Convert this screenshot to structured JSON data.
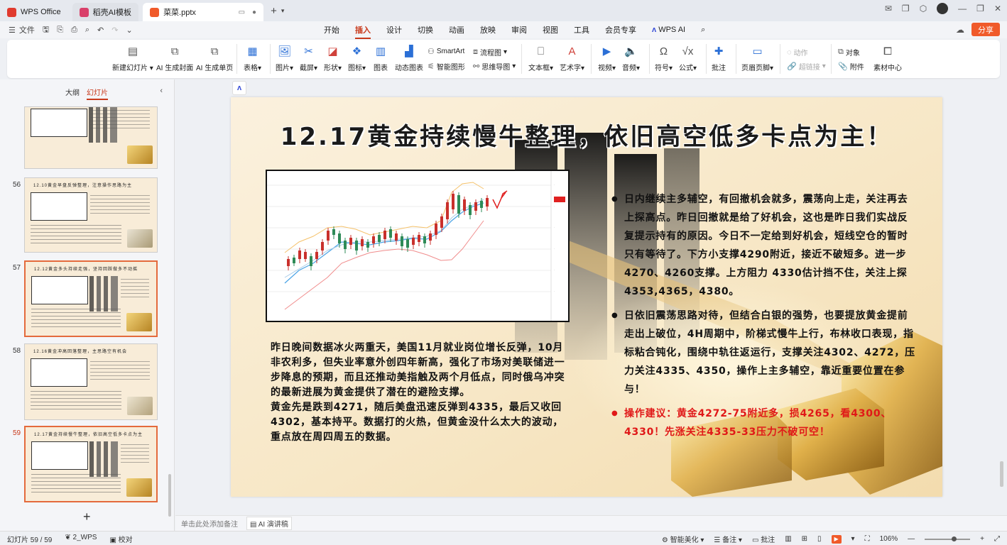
{
  "tabs": [
    {
      "label": "WPS Office",
      "color": "#e03a2e"
    },
    {
      "label": "稻壳AI模板",
      "color": "#d9406a"
    },
    {
      "label": "菜菜.pptx",
      "color": "#f05a2a"
    }
  ],
  "menu": {
    "file": "文件",
    "tabs": [
      "开始",
      "插入",
      "设计",
      "切换",
      "动画",
      "放映",
      "审阅",
      "视图",
      "工具",
      "会员专享",
      "WPS AI"
    ],
    "active_tab": "插入",
    "share": "分享"
  },
  "ribbon": {
    "new_slide": "新建幻灯片",
    "ai_cover": "AI 生成封面",
    "ai_page": "AI 生成单页",
    "table": "表格",
    "picture": "图片",
    "screenshot": "截屏",
    "shape": "形状",
    "icon": "图标",
    "chart": "图表",
    "dynamic_chart": "动态图表",
    "smartart": "SmartArt",
    "smart_shape": "智能图形",
    "flowchart": "流程图",
    "mindmap": "思维导图",
    "textbox": "文本框",
    "wordart": "艺术字",
    "video": "视频",
    "audio": "音频",
    "symbol": "符号",
    "formula": "公式",
    "comment": "批注",
    "header_footer": "页眉页脚",
    "action": "动作",
    "hyperlink": "超链接",
    "object": "对象",
    "attachment": "附件",
    "material": "素材中心"
  },
  "left_panel": {
    "outline_tab": "大纲",
    "slides_tab": "幻灯片",
    "thumbs": [
      {
        "num": "",
        "title": ""
      },
      {
        "num": "56",
        "title": "12.10黄金早盘反弹整理，注意操作思路为主"
      },
      {
        "num": "57",
        "title": "12.12黄金多头持续走强，坚持回踩做多不动摇"
      },
      {
        "num": "58",
        "title": "12.16黄金冲高回落整理，主思路空有机会"
      },
      {
        "num": "59",
        "title": "12.17黄金持续慢牛整理，依旧高空低多卡点为主"
      }
    ],
    "add": "+"
  },
  "slide": {
    "title": "12.17黄金持续慢牛整理，依旧高空低多卡点为主！",
    "paragraph_1": "昨日晚间数据冰火两重天，美国11月就业岗位增长反弹，10月非农利多，但失业率意外创四年新高，强化了市场对美联储进一步降息的预期，而且还推动美指触及两个月低点，同时俄乌冲突的最新进展为黄金提供了潜在的避险支撑。",
    "paragraph_2": "黄金先是跌到4271，随后美盘迅速反弹到4335，最后又收回4302，基本持平。数据打的火热，但黄金没什么太大的波动，重点放在周四周五的数据。",
    "bullet_1": "日内继续主多辅空，有回撤机会就多，震荡向上走，关注再去上探高点。昨日回撤就是给了好机会，这也是昨日我们实战反复提示持有的原因。今日不一定给到好机会，短线空仓的暂时只有等待了。下方小支撑4290附近，接近不破短多。进一步4270、4260支撑。上方阻力 4330估计挡不住，关注上探4353,4365，4380。",
    "bullet_2": "日依旧震荡思路对待，但结合白银的强势，也要提放黄金提前走出上破位，4H周期中，阶梯式慢牛上行，布林收口表现，指标粘合钝化，围绕中轨往返运行，支撑关注4302、4272，压力关注4335、4350，操作上主多辅空，靠近重要位置在参与！",
    "bullet_3": "操作建议：黄金4272-75附近多，损4265，看4300、4330！先涨关注4335-33压力不破可空！",
    "bullet_3_color": "#e01818"
  },
  "notes": {
    "placeholder": "单击此处添加备注",
    "ai_lecture": "AI 演讲稿"
  },
  "status": {
    "slide_count": "幻灯片 59 / 59",
    "theme": "2_WPS",
    "proof": "校对",
    "beautify": "智能美化",
    "notes": "备注",
    "comments": "批注",
    "zoom": "106%"
  }
}
